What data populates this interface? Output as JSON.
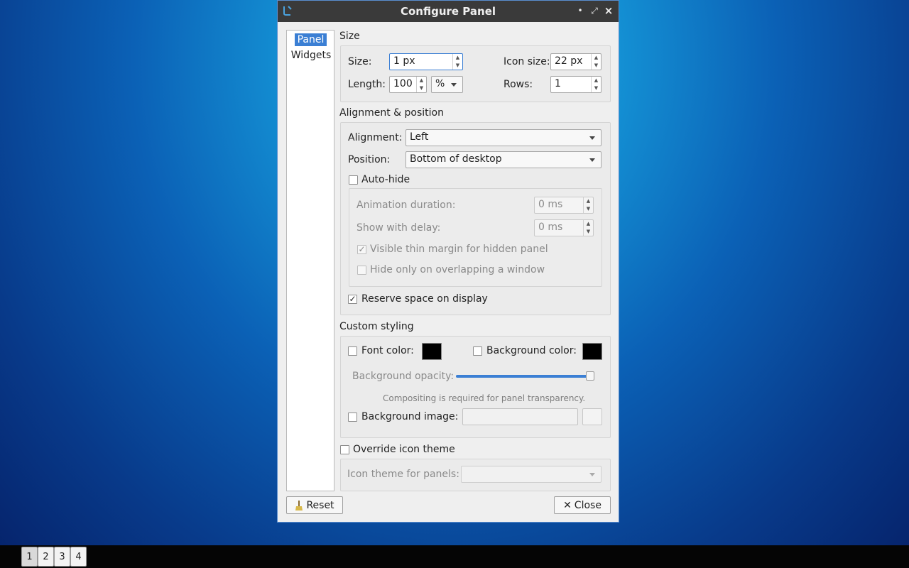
{
  "window": {
    "title": "Configure Panel",
    "close_glyph": "×",
    "maximize_glyph": "⤢",
    "minimize_glyph": "•"
  },
  "sidebar": {
    "items": [
      {
        "label": "Panel",
        "selected": true
      },
      {
        "label": "Widgets",
        "selected": false
      }
    ]
  },
  "size_section": {
    "title": "Size",
    "size_label": "Size:",
    "size_value": "1 px",
    "icon_size_label": "Icon size:",
    "icon_size_value": "22 px",
    "length_label": "Length:",
    "length_value": "100",
    "length_unit": "%",
    "rows_label": "Rows:",
    "rows_value": "1"
  },
  "alignment_section": {
    "title": "Alignment & position",
    "alignment_label": "Alignment:",
    "alignment_value": "Left",
    "position_label": "Position:",
    "position_value": "Bottom of desktop",
    "autohide_label": "Auto-hide",
    "autohide_checked": false,
    "animation_label": "Animation duration:",
    "animation_value": "0 ms",
    "delay_label": "Show with delay:",
    "delay_value": "0 ms",
    "thin_margin_label": "Visible thin margin for hidden panel",
    "thin_margin_checked": true,
    "overlap_label": "Hide only on overlapping a window",
    "overlap_checked": false,
    "reserve_label": "Reserve space on display",
    "reserve_checked": true
  },
  "styling_section": {
    "title": "Custom styling",
    "font_color_label": "Font color:",
    "font_color": "#000000",
    "bg_color_label": "Background color:",
    "bg_color": "#000000",
    "opacity_label": "Background opacity:",
    "opacity_percent": 100,
    "compositing_hint": "Compositing is required for panel transparency.",
    "bg_image_label": "Background image:",
    "bg_image_value": ""
  },
  "icon_theme": {
    "override_label": "Override icon theme",
    "override_checked": false,
    "theme_label": "Icon theme for panels:",
    "theme_value": ""
  },
  "buttons": {
    "reset_label": "Reset",
    "close_label": "Close"
  },
  "taskbar": {
    "desktops": [
      "1",
      "2",
      "3",
      "4"
    ],
    "active": "1"
  },
  "colors": {
    "accent": "#3b7fd4",
    "titlebar": "#3a3a3a"
  }
}
